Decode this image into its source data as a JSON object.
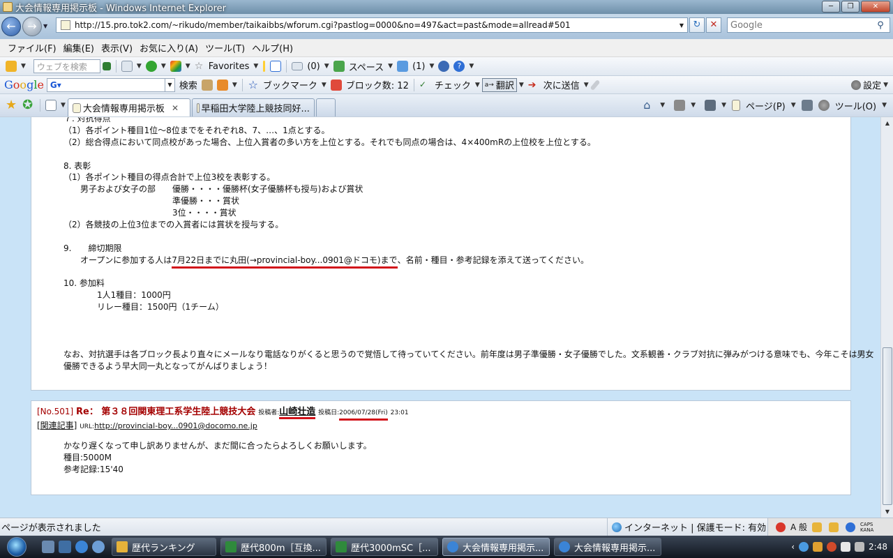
{
  "window": {
    "title": "大会情報専用掲示板 - Windows Internet Explorer",
    "min": "0",
    "max": "1",
    "close": "r"
  },
  "address": {
    "url": "http://15.pro.tok2.com/~rikudo/member/taikaibbs/wforum.cgi?pastlog=0000&no=497&act=past&mode=allread#501",
    "search_placeholder": "Google"
  },
  "menu": [
    "ファイル(F)",
    "編集(E)",
    "表示(V)",
    "お気に入り(A)",
    "ツール(T)",
    "ヘルプ(H)"
  ],
  "toolbar1": {
    "search_placeholder": "ウェブを検索",
    "favorites": "Favorites",
    "mail_count": "(0)",
    "space": "スペース",
    "friends_count": "(1)"
  },
  "toolbar2": {
    "logo": [
      "G",
      "o",
      "o",
      "g",
      "l",
      "e"
    ],
    "search_button": "検索",
    "bookmarks": "ブックマーク",
    "blocked": "ブロック数: 12",
    "check": "チェック",
    "translate": "翻訳",
    "send": "次に送信",
    "settings": "設定"
  },
  "tabs": [
    {
      "label": "大会情報専用掲示板",
      "active": true
    },
    {
      "label": "早稲田大学陸上競技同好...",
      "active": false
    }
  ],
  "command_bar": {
    "page": "ページ(P)",
    "tools": "ツール(O)"
  },
  "post1": {
    "lines": [
      "７. 対抗得点",
      "（1）各ポイント種目1位～8位までをそれぞれ8、7、…、1点とする。",
      "（2）総合得点において同点校があった場合、上位入賞者の多い方を上位とする。それでも同点の場合は、4×400mRの上位校を上位とする。",
      "",
      "8. 表彰",
      "（1）各ポイント種目の得点合計で上位3校を表彰する。",
      "　　男子および女子の部　　優勝・・・・優勝杯(女子優勝杯も授与)および賞状",
      "　　　　　　　　　　　　　準優勝・・・賞状",
      "　　　　　　　　　　　　　3位・・・・賞状",
      "（2）各競技の上位3位までの入賞者には賞状を授与する。",
      "",
      "9.　　締切期限"
    ],
    "deadline_prefix": "　　オープンに参加する人は",
    "deadline_underlined": "7月22日までに丸田(→provincial-boy...0901@ドコモ)まで",
    "deadline_suffix": "、名前・種目・参考記録を添えて送ってください。",
    "fee_lines": [
      "",
      "10. 参加料",
      "　　　　1人1種目：1000円",
      "　　　　リレー種目：1500円（1チーム）",
      "",
      "",
      "",
      "なお、対抗選手は各ブロック長より直々にメールなり電話なりがくると思うので覚悟して待っていてください。前年度は男子準優勝・女子優勝でした。文系観善・クラブ対抗に弾みがつける意味でも、今年こそは男女",
      "優勝できるよう早大同一丸となってがんばりましょう！"
    ]
  },
  "post2": {
    "no": "[No.501]",
    "re": "Re： 第３８回関東理工系学生陸上競技大会",
    "author_label": "投稿者:",
    "author": "山崎壮造",
    "date_label": "投稿日:",
    "date": "2006/07/28(Fri)",
    "time": "23:01",
    "related": "[関連記事]",
    "url_label": "URL:",
    "url": "http://provincial-boy...0901@docomo.ne.jp",
    "body": [
      "かなり遅くなって申し訳ありませんが、まだ間に合ったらよろしくお願いします。",
      "種目:5000M",
      "参考記録:15'40"
    ]
  },
  "status": {
    "text": "ページが表示されました",
    "zone": "インターネット | 保護モード: 有効",
    "ime": "A 般",
    "caps": "CAPS",
    "kana": "KANA"
  },
  "taskbar": {
    "tasks": [
      {
        "label": "歴代ランキング",
        "color": "#e6b23a",
        "active": false
      },
      {
        "label": "歴代800m［互換...",
        "color": "#2f8a3c",
        "active": false
      },
      {
        "label": "歴代3000mSC［...",
        "color": "#2f8a3c",
        "active": false
      },
      {
        "label": "大会情報専用掲示...",
        "color": "#3b84d6",
        "active": true
      },
      {
        "label": "大会情報専用掲示...",
        "color": "#3b84d6",
        "active": false
      }
    ],
    "clock": "2:48"
  }
}
